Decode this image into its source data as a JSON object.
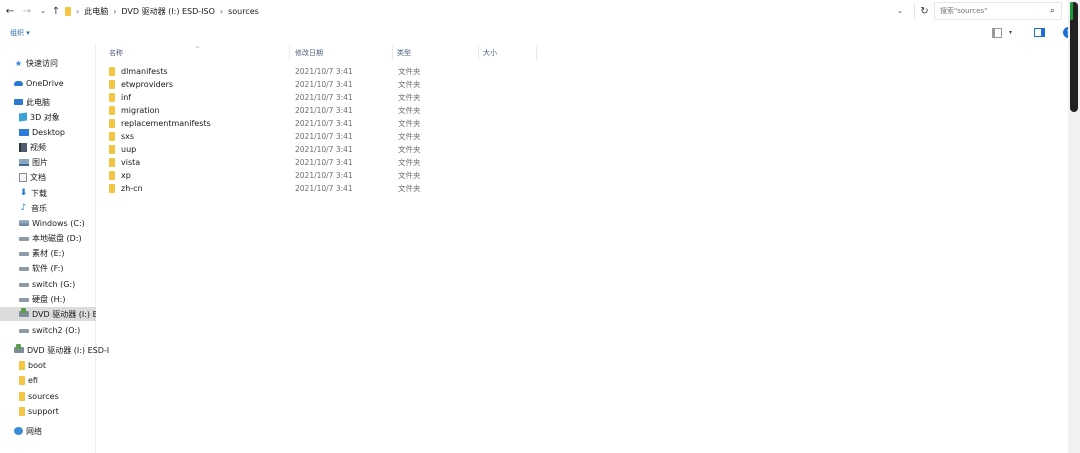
{
  "address": {
    "back_glyph": "←",
    "forward_glyph": "→",
    "recent_glyph": "⌄",
    "up_glyph": "↑",
    "crumbs": [
      "此电脑",
      "DVD 驱动器 (I:) ESD-ISO",
      "sources"
    ],
    "sep": "›",
    "dropdown_glyph": "⌄",
    "refresh_glyph": "↻",
    "search_placeholder": "搜索\"sources\"",
    "search_glyph": "⌕"
  },
  "toolbar": {
    "organize": "组织 ▾",
    "view_chev": "▾",
    "help": "?"
  },
  "sidebar": {
    "items": [
      {
        "label": "快速访问",
        "icon": "star-icon"
      },
      {
        "label": "OneDrive",
        "icon": "cloud-icon"
      },
      {
        "label": "此电脑",
        "icon": "computer-icon"
      },
      {
        "label": "3D 对象",
        "icon": "cube-icon"
      },
      {
        "label": "Desktop",
        "icon": "desktop-icon"
      },
      {
        "label": "视频",
        "icon": "video-icon"
      },
      {
        "label": "图片",
        "icon": "picture-icon"
      },
      {
        "label": "文档",
        "icon": "document-icon"
      },
      {
        "label": "下载",
        "icon": "download-icon"
      },
      {
        "label": "音乐",
        "icon": "music-icon"
      },
      {
        "label": "Windows (C:)",
        "icon": "windows-drive-icon"
      },
      {
        "label": "本地磁盘 (D:)",
        "icon": "drive-icon"
      },
      {
        "label": "素材 (E:)",
        "icon": "drive-icon"
      },
      {
        "label": "软件 (F:)",
        "icon": "drive-icon"
      },
      {
        "label": "switch (G:)",
        "icon": "drive-icon"
      },
      {
        "label": "硬盘 (H:)",
        "icon": "drive-icon"
      },
      {
        "label": "DVD 驱动器 (I:) ESD-ISO",
        "icon": "dvd-icon"
      },
      {
        "label": "switch2 (O:)",
        "icon": "drive-icon"
      },
      {
        "label": "DVD 驱动器 (I:) ESD-ISO",
        "icon": "dvd-icon"
      },
      {
        "label": "boot",
        "icon": "folder-icon"
      },
      {
        "label": "efi",
        "icon": "folder-icon"
      },
      {
        "label": "sources",
        "icon": "folder-icon"
      },
      {
        "label": "support",
        "icon": "folder-icon"
      },
      {
        "label": "网络",
        "icon": "network-icon"
      }
    ],
    "star_glyph": "★",
    "down_glyph": "⬇",
    "music_glyph": "♪"
  },
  "columns": {
    "name": "名称",
    "modified": "修改日期",
    "type": "类型",
    "size": "大小",
    "sort_glyph": "^"
  },
  "files": [
    {
      "name": "dlmanifests",
      "modified": "2021/10/7 3:41",
      "type": "文件夹"
    },
    {
      "name": "etwproviders",
      "modified": "2021/10/7 3:41",
      "type": "文件夹"
    },
    {
      "name": "inf",
      "modified": "2021/10/7 3:41",
      "type": "文件夹"
    },
    {
      "name": "migration",
      "modified": "2021/10/7 3:41",
      "type": "文件夹"
    },
    {
      "name": "replacementmanifests",
      "modified": "2021/10/7 3:41",
      "type": "文件夹"
    },
    {
      "name": "sxs",
      "modified": "2021/10/7 3:41",
      "type": "文件夹"
    },
    {
      "name": "uup",
      "modified": "2021/10/7 3:41",
      "type": "文件夹"
    },
    {
      "name": "vista",
      "modified": "2021/10/7 3:41",
      "type": "文件夹"
    },
    {
      "name": "xp",
      "modified": "2021/10/7 3:41",
      "type": "文件夹"
    },
    {
      "name": "zh-cn",
      "modified": "2021/10/7 3:41",
      "type": "文件夹"
    }
  ],
  "colors": {
    "folder": "#f4c542",
    "accent": "#1f6ed4",
    "selected_bg": "#dcdcdc"
  }
}
